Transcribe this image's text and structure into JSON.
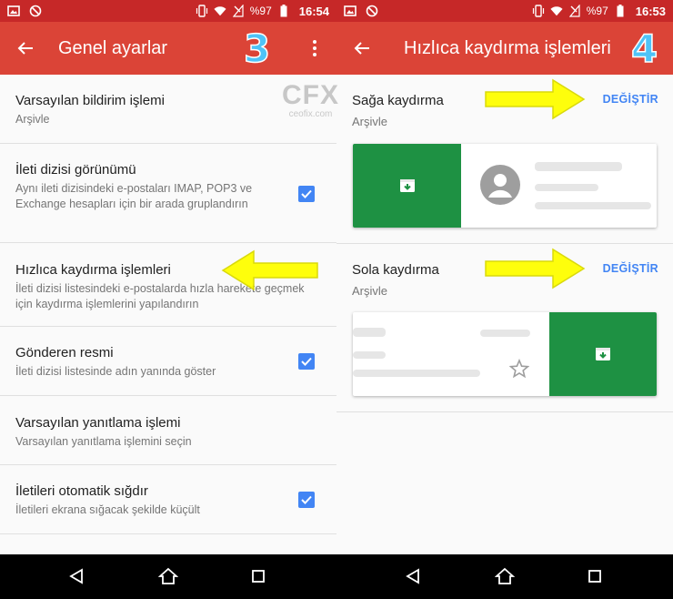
{
  "left": {
    "status": {
      "battery": "%97",
      "time": "16:54"
    },
    "appbar": {
      "title": "Genel ayarlar",
      "step": "3"
    },
    "settings": [
      {
        "title": "Varsayılan bildirim işlemi",
        "sub": "Arşivle",
        "checkbox": false
      },
      {
        "title": "İleti dizisi görünümü",
        "sub": "Aynı ileti dizisindeki e-postaları IMAP, POP3 ve Exchange hesapları için bir arada gruplandırın",
        "checkbox": true
      },
      {
        "title": "Hızlıca kaydırma işlemleri",
        "sub": "İleti dizisi listesindeki e-postalarda hızla harekete geçmek için kaydırma işlemlerini yapılandırın",
        "checkbox": false
      },
      {
        "title": "Gönderen resmi",
        "sub": "İleti dizisi listesinde adın yanında göster",
        "checkbox": true
      },
      {
        "title": "Varsayılan yanıtlama işlemi",
        "sub": "Varsayılan yanıtlama işlemini seçin",
        "checkbox": false
      },
      {
        "title": "İletileri otomatik sığdır",
        "sub": "İletileri ekrana sığacak şekilde küçült",
        "checkbox": true
      }
    ]
  },
  "right": {
    "status": {
      "battery": "%97",
      "time": "16:53"
    },
    "appbar": {
      "title": "Hızlıca kaydırma işlemleri",
      "step": "4"
    },
    "right_swipe": {
      "label": "Sağa kaydırma",
      "action": "Arşivle",
      "button": "DEĞİŞTİR"
    },
    "left_swipe": {
      "label": "Sola kaydırma",
      "action": "Arşivle",
      "button": "DEĞİŞTİR"
    }
  },
  "watermark": {
    "logo": "CFX",
    "site": "ceofix.com"
  },
  "colors": {
    "statusbar": "#c62828",
    "appbar": "#db4437",
    "accent": "#4285f4",
    "swipe_green": "#1e9143",
    "arrow": "#ffff00"
  },
  "icons": [
    "image-icon",
    "block-icon",
    "vibrate-icon",
    "wifi-icon",
    "no-signal-icon",
    "battery-icon",
    "back-arrow-icon",
    "more-vert-icon",
    "archive-icon",
    "avatar-icon",
    "star-icon",
    "nav-back-icon",
    "nav-home-icon",
    "nav-recents-icon"
  ]
}
